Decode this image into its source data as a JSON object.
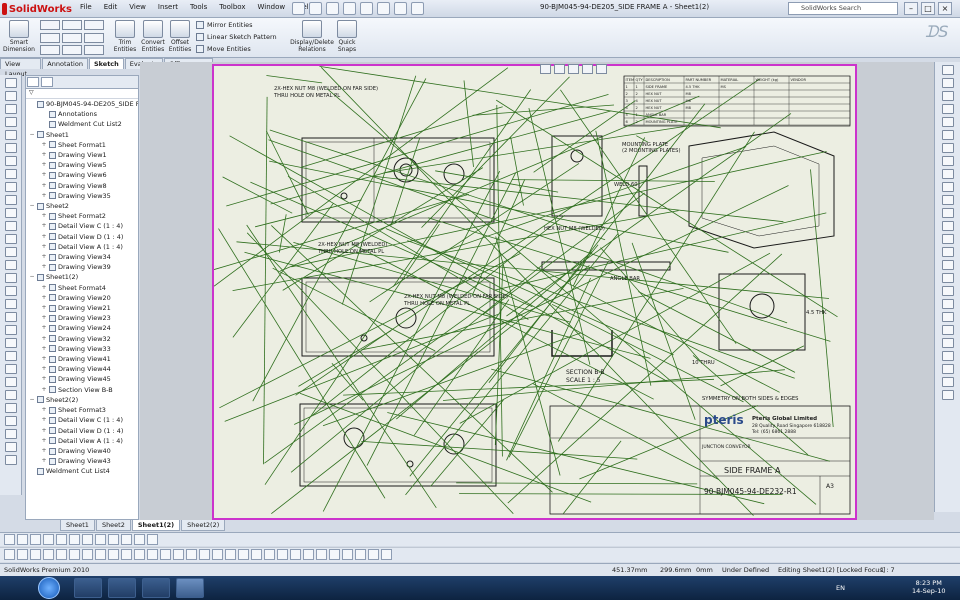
{
  "app": {
    "name": "SolidWorks"
  },
  "menu": [
    "File",
    "Edit",
    "View",
    "Insert",
    "Tools",
    "Toolbox",
    "Window",
    "Help"
  ],
  "window_title": "90-BJM045-94-DE205_SIDE FRAME A - Sheet1(2)",
  "search": {
    "placeholder": "SolidWorks Search"
  },
  "command_manager": {
    "smart_dimension": "Smart Dimension",
    "trim_entities": "Trim Entities",
    "convert_entities": "Convert Entities",
    "offset_entities": "Offset Entities",
    "mirror_entities": "Mirror Entities",
    "linear_sketch_pattern": "Linear Sketch Pattern",
    "move_entities": "Move Entities",
    "display_delete_relations": "Display/Delete Relations",
    "quick_snaps": "Quick Snaps"
  },
  "cmd_tabs": [
    "View Layout",
    "Annotation",
    "Sketch",
    "Evaluate",
    "Office Products"
  ],
  "active_cmd_tab": "Sketch",
  "tree": [
    {
      "label": "90-BJM045-94-DE205_SIDE FRAME",
      "level": 0
    },
    {
      "label": "Annotations",
      "level": 1
    },
    {
      "label": "Weldment Cut List2",
      "level": 1
    },
    {
      "label": "Sheet1",
      "level": 0,
      "toggle": "−"
    },
    {
      "label": "Sheet Format1",
      "level": 1,
      "toggle": "+"
    },
    {
      "label": "Drawing View1",
      "level": 1,
      "toggle": "+"
    },
    {
      "label": "Drawing View5",
      "level": 1,
      "toggle": "+"
    },
    {
      "label": "Drawing View6",
      "level": 1,
      "toggle": "+"
    },
    {
      "label": "Drawing View8",
      "level": 1,
      "toggle": "+"
    },
    {
      "label": "Drawing View35",
      "level": 1,
      "toggle": "+"
    },
    {
      "label": "Sheet2",
      "level": 0,
      "toggle": "−"
    },
    {
      "label": "Sheet Format2",
      "level": 1,
      "toggle": "+"
    },
    {
      "label": "Detail View C (1 : 4)",
      "level": 1,
      "toggle": "+"
    },
    {
      "label": "Detail View D (1 : 4)",
      "level": 1,
      "toggle": "+"
    },
    {
      "label": "Detail View A (1 : 4)",
      "level": 1,
      "toggle": "+"
    },
    {
      "label": "Drawing View34",
      "level": 1,
      "toggle": "+"
    },
    {
      "label": "Drawing View39",
      "level": 1,
      "toggle": "+"
    },
    {
      "label": "Sheet1(2)",
      "level": 0,
      "toggle": "−"
    },
    {
      "label": "Sheet Format4",
      "level": 1,
      "toggle": "+"
    },
    {
      "label": "Drawing View20",
      "level": 1,
      "toggle": "+"
    },
    {
      "label": "Drawing View21",
      "level": 1,
      "toggle": "+"
    },
    {
      "label": "Drawing View23",
      "level": 1,
      "toggle": "+"
    },
    {
      "label": "Drawing View24",
      "level": 1,
      "toggle": "+"
    },
    {
      "label": "Drawing View32",
      "level": 1,
      "toggle": "+"
    },
    {
      "label": "Drawing View33",
      "level": 1,
      "toggle": "+"
    },
    {
      "label": "Drawing View41",
      "level": 1,
      "toggle": "+"
    },
    {
      "label": "Drawing View44",
      "level": 1,
      "toggle": "+"
    },
    {
      "label": "Drawing View45",
      "level": 1,
      "toggle": "+"
    },
    {
      "label": "Section View B-B",
      "level": 1,
      "toggle": "+"
    },
    {
      "label": "Sheet2(2)",
      "level": 0,
      "toggle": "−"
    },
    {
      "label": "Sheet Format3",
      "level": 1,
      "toggle": "+"
    },
    {
      "label": "Detail View C (1 : 4)",
      "level": 1,
      "toggle": "+"
    },
    {
      "label": "Detail View D (1 : 4)",
      "level": 1,
      "toggle": "+"
    },
    {
      "label": "Detail View A (1 : 4)",
      "level": 1,
      "toggle": "+"
    },
    {
      "label": "Drawing View40",
      "level": 1,
      "toggle": "+"
    },
    {
      "label": "Drawing View43",
      "level": 1,
      "toggle": "+"
    },
    {
      "label": "Weldment Cut List4",
      "level": 0
    }
  ],
  "sheet_tabs": [
    "Sheet1",
    "Sheet2",
    "Sheet1(2)",
    "Sheet2(2)"
  ],
  "active_sheet": "Sheet1(2)",
  "drawing": {
    "callout_top": "2X-HEX NUT M8 (WELDED ON FAR SIDE)",
    "callout_top2": "THRU HOLE ON METAL PL",
    "callout_mid": "2X-HEX NUT M8 (WELDED ON FAR SIDE)",
    "callout_mid2": "THRU HOLE ON METAL PL",
    "callout_low": "2X-HEX NUT M8 (WELDED)",
    "callout_low2": "THRU HOLE ON METAL PL",
    "mounting_plate": "MOUNTING PLATE",
    "mounting_plate2": "(2 MOUNTING PLATES)",
    "weld_note": "WELD 60",
    "hex_nut_label": "HEX NUT M8 (WELDED)",
    "angle_bar": "ANGLE BAR",
    "section": "SECTION B-B",
    "scale": "SCALE 1 : 5",
    "thru": "10 THRU",
    "thk": "4.5 THK",
    "symmetry_note": "SYMMETRY ON BOTH SIDES & EDGES",
    "company": "Pteris Global Limited",
    "company_addr": "28 Quality Road Singapore 618828",
    "company_tel": "Tel: (65) 6861 2888",
    "logo_text": "pteris",
    "drawing_title": "SIDE FRAME A",
    "drawing_number": "90-BJM045-94-DE232-R1",
    "sheet_size": "A3",
    "junction_label": "JUNCTION CONVEYOR",
    "bom_headers": [
      "ITEM",
      "QTY",
      "DESCRIPTION",
      "PART NUMBER",
      "MATERIAL",
      "WEIGHT (kg)",
      "VENDOR"
    ],
    "bom_rows": [
      [
        "1",
        "1",
        "SIDE FRAME",
        "4.5 THK",
        "MS",
        "",
        ""
      ],
      [
        "2",
        "2",
        "HEX NUT",
        "M8",
        "",
        "",
        ""
      ],
      [
        "3",
        "4",
        "HEX NUT",
        "M8",
        "",
        "",
        ""
      ],
      [
        "4",
        "2",
        "HEX NUT",
        "M8",
        "",
        "",
        ""
      ],
      [
        "5",
        "1",
        "ANGLE BAR",
        "",
        "",
        "",
        ""
      ],
      [
        "6",
        "2",
        "MOUNTING PLATE",
        "",
        "",
        "",
        ""
      ]
    ]
  },
  "status": {
    "product": "SolidWorks Premium 2010",
    "x": "451.37mm",
    "y": "299.6mm",
    "z": "0mm",
    "state": "Under Defined",
    "editing": "Editing Sheet1(2) [Locked Focus]",
    "scale": "1 : 7"
  },
  "taskbar": {
    "lang": "EN",
    "time": "8:23 PM",
    "date": "14-Sep-10"
  },
  "colors": {
    "sheet_border": "#cc33cc",
    "sketch_lines": "#2f6f1e",
    "drawing_lines": "#1a1a1a",
    "accent": "#c11111"
  }
}
